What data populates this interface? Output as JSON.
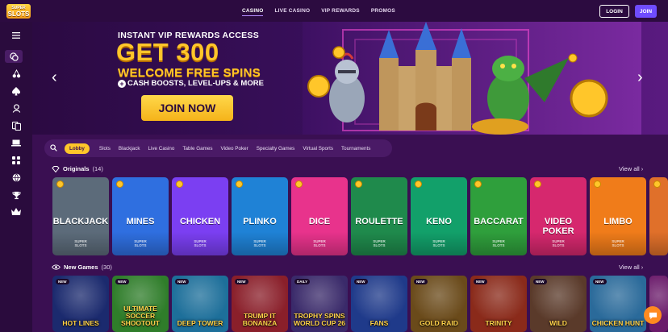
{
  "logo": {
    "line1": "SUPER",
    "line2": "SLOTS"
  },
  "nav": {
    "items": [
      "CASINO",
      "LIVE CASINO",
      "VIP REWARDS",
      "PROMOS"
    ]
  },
  "auth": {
    "login": "LOGIN",
    "join": "JOIN"
  },
  "sidebar": {
    "icons": [
      "menu-icon",
      "chips-icon",
      "cherry-icon",
      "spade-icon",
      "dealer-icon",
      "video-poker-icon",
      "laptop-icon",
      "dice-icon",
      "sports-icon",
      "trophy-icon",
      "crown-icon"
    ]
  },
  "hero": {
    "line1": "INSTANT VIP REWARDS ACCESS",
    "line2": "GET 300",
    "line3": "WELCOME FREE SPINS",
    "line4": "CASH BOOSTS, LEVEL-UPS & MORE",
    "cta": "JOIN NOW",
    "prev": "‹",
    "next": "›"
  },
  "filters": {
    "items": [
      "Lobby",
      "Slots",
      "Blackjack",
      "Live Casino",
      "Table Games",
      "Video Poker",
      "Specialty Games",
      "Virtual Sports",
      "Tournaments"
    ]
  },
  "originals": {
    "title": "Originals",
    "count": "(14)",
    "view_all": "View all",
    "games": [
      {
        "name": "BLACKJACK",
        "color": "#5c6b7a"
      },
      {
        "name": "MINES",
        "color": "#2f6fe0"
      },
      {
        "name": "CHICKEN",
        "color": "#7b3ff2"
      },
      {
        "name": "PLINKO",
        "color": "#1f82d6"
      },
      {
        "name": "DICE",
        "color": "#e8338c"
      },
      {
        "name": "ROULETTE",
        "color": "#1f8a4c"
      },
      {
        "name": "KENO",
        "color": "#12a06a"
      },
      {
        "name": "BACCARAT",
        "color": "#2f9f3c"
      },
      {
        "name": "VIDEO POKER",
        "color": "#d6286e"
      },
      {
        "name": "LIMBO",
        "color": "#f07c1a"
      },
      {
        "name": "",
        "color": "#e0702a"
      }
    ],
    "brand_line1": "SUPER",
    "brand_line2": "SLOTS"
  },
  "new_games": {
    "title": "New Games",
    "count": "(30)",
    "view_all": "View all",
    "badge": "NEW",
    "games": [
      {
        "name": "HOT LINES",
        "color": "#1b2a6e",
        "badge": "NEW"
      },
      {
        "name": "ULTIMATE SOCCER SHOOTOUT",
        "color": "#2f7d2a",
        "badge": "NEW"
      },
      {
        "name": "DEEP TOWER",
        "color": "#1d6f9a",
        "badge": "NEW"
      },
      {
        "name": "TRUMP IT BONANZA",
        "color": "#8a1f2a",
        "badge": "NEW"
      },
      {
        "name": "TROPHY SPINS WORLD CUP 26",
        "color": "#3a2a6a",
        "badge": "DAILY"
      },
      {
        "name": "FANS",
        "color": "#1f3a8a",
        "badge": "NEW"
      },
      {
        "name": "GOLD RAID",
        "color": "#6a4a1a",
        "badge": "NEW"
      },
      {
        "name": "TRINITY",
        "color": "#8a2a1a",
        "badge": "NEW"
      },
      {
        "name": "WILD",
        "color": "#5a3a2a",
        "badge": "NEW"
      },
      {
        "name": "CHICKEN HUNT",
        "color": "#2a6a9a",
        "badge": "NEW"
      },
      {
        "name": "",
        "color": "#6a1a6a",
        "badge": ""
      }
    ]
  },
  "colors": {
    "bg": "#3a0f52",
    "accent_yellow": "#ffc62a",
    "join_purple": "#6f4cff"
  }
}
